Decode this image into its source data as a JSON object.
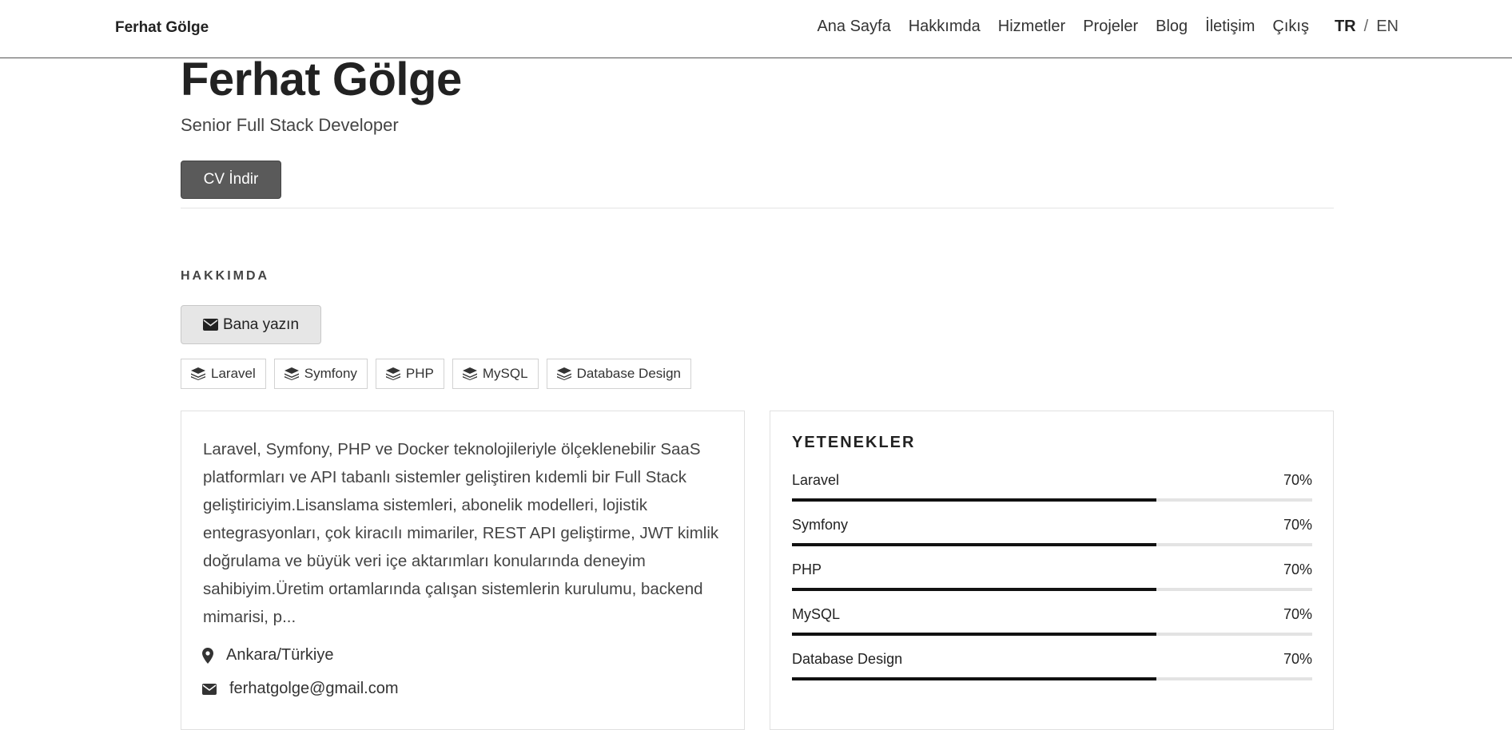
{
  "nav": {
    "brand": "Ferhat Gölge",
    "links": [
      "Ana Sayfa",
      "Hakkımda",
      "Hizmetler",
      "Projeler",
      "Blog",
      "İletişim",
      "Çıkış"
    ],
    "lang_tr": "TR",
    "lang_sep": "/",
    "lang_en": "EN"
  },
  "hero": {
    "name": "Ferhat Gölge",
    "title": "Senior Full Stack Developer",
    "cv_button": "CV İndir"
  },
  "about": {
    "heading": "HAKKIMDA",
    "write_button": "Bana yazın",
    "tags": [
      "Laravel",
      "Symfony",
      "PHP",
      "MySQL",
      "Database Design"
    ],
    "text": "Laravel, Symfony, PHP ve Docker teknolojileriyle ölçeklenebilir SaaS platformları ve API tabanlı sistemler geliştiren kıdemli bir Full Stack geliştiriciyim.Lisanslama sistemleri, abonelik modelleri, lojistik entegrasyonları, çok kiracılı mimariler, REST API geliştirme, JWT kimlik doğrulama ve büyük veri içe aktarımları konularında deneyim sahibiyim.Üretim ortamlarında çalışan sistemlerin kurulumu, backend mimarisi, p...",
    "location": "Ankara/Türkiye",
    "email": "ferhatgolge@gmail.com"
  },
  "skills": {
    "title": "YETENEKLER",
    "items": [
      {
        "name": "Laravel",
        "percent_label": "70%",
        "percent": 70
      },
      {
        "name": "Symfony",
        "percent_label": "70%",
        "percent": 70
      },
      {
        "name": "PHP",
        "percent_label": "70%",
        "percent": 70
      },
      {
        "name": "MySQL",
        "percent_label": "70%",
        "percent": 70
      },
      {
        "name": "Database Design",
        "percent_label": "70%",
        "percent": 70
      }
    ]
  },
  "icons": {
    "tag": "layers-icon",
    "write": "envelope-icon",
    "location": "map-marker-icon",
    "email": "envelope-icon"
  }
}
